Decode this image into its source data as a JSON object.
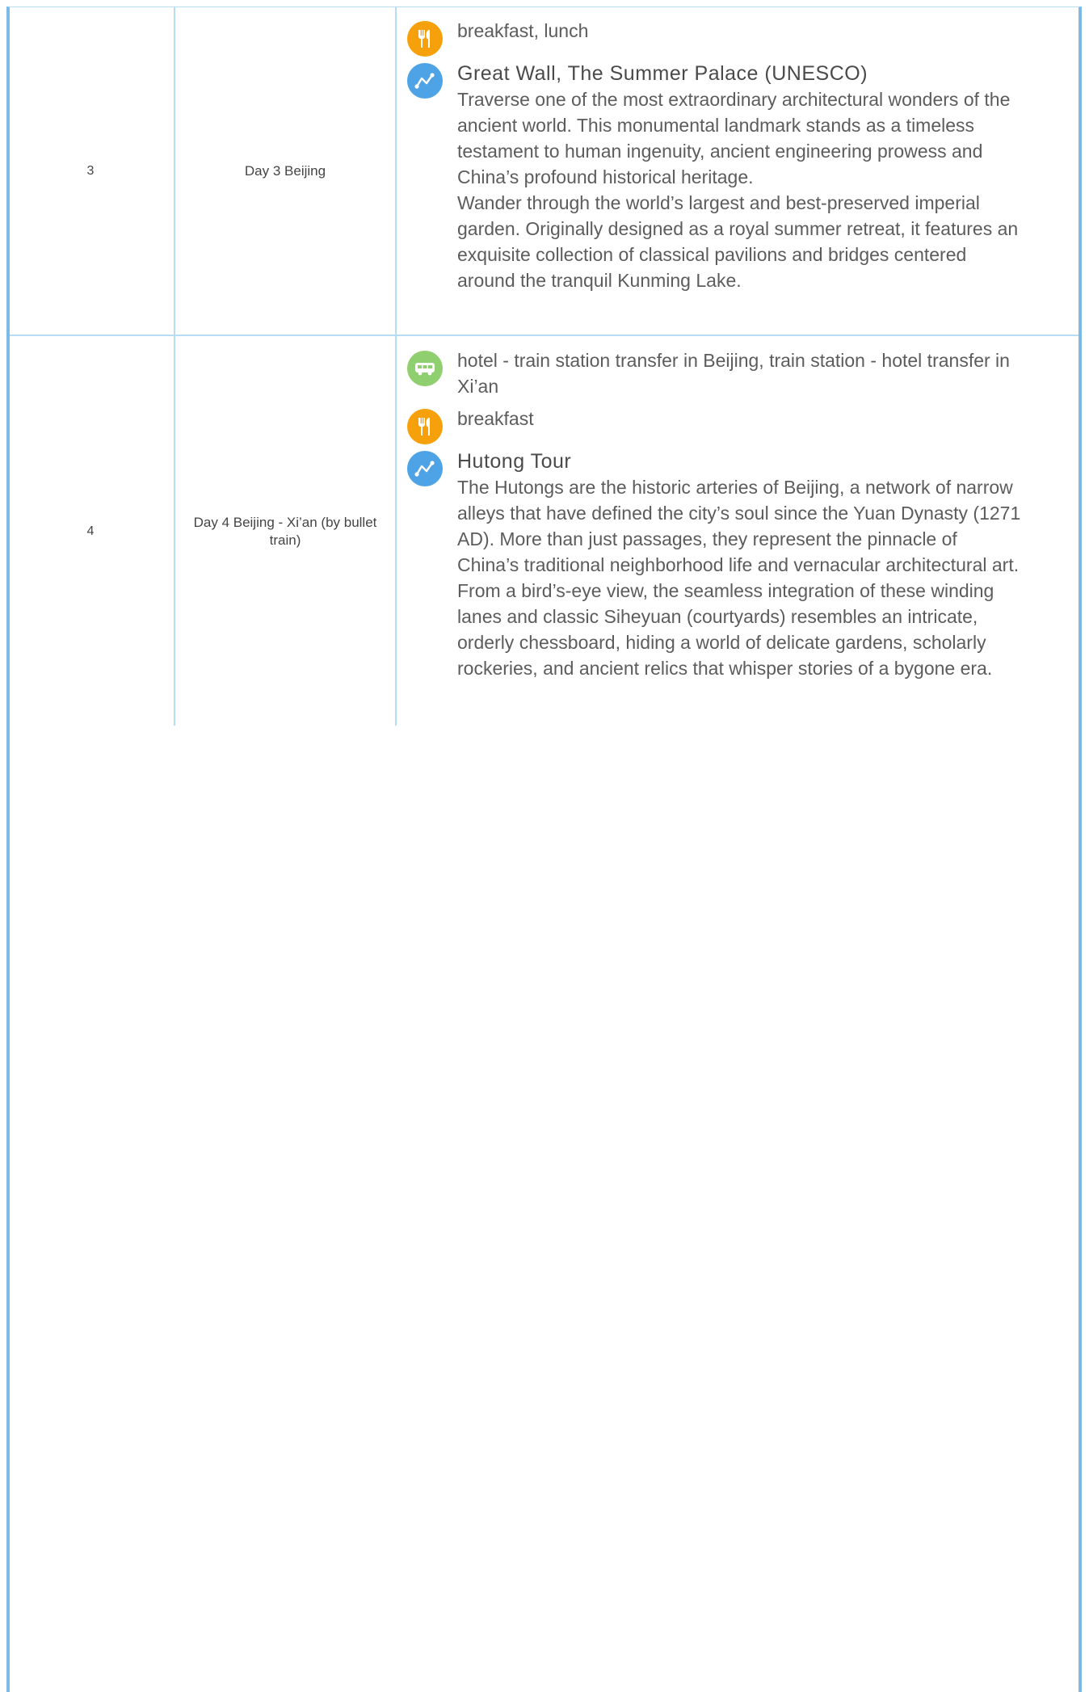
{
  "itinerary": {
    "rows": [
      {
        "number": "3",
        "day": "Day 3 Beijing",
        "meals": "breakfast, lunch",
        "sight_title": "Great Wall, The Summer Palace (UNESCO)",
        "sight_desc_1": "Traverse one of the most extraordinary architectural wonders of the ancient world. This monumental landmark stands as a timeless testament to human ingenuity, ancient engineering prowess and China’s profound historical heritage.",
        "sight_desc_2": "Wander through the world’s largest and best-preserved imperial garden. Originally designed as a royal summer retreat, it features an exquisite collection of classical pavilions and bridges centered around the tranquil Kunming Lake."
      },
      {
        "number": "4",
        "day": "Day 4 Beijing - Xi’an (by bullet train)",
        "transfer": "hotel - train station transfer in Beijing, train station - hotel transfer in Xi’an",
        "meals": "breakfast",
        "sight_title": "Hutong Tour",
        "sight_desc": "The Hutongs are the historic arteries of Beijing, a network of narrow alleys that have defined the city’s soul since the Yuan Dynasty (1271 AD). More than just passages, they represent the pinnacle of China’s traditional neighborhood life and vernacular architectural art. From a bird’s-eye view, the seamless integration of these winding lanes and classic Siheyuan (courtyards) resembles an intricate, orderly chessboard, hiding a world of delicate gardens, scholarly rockeries, and ancient relics that whisper stories of a bygone era."
      }
    ],
    "icons": {
      "meal": "fork-knife-icon",
      "sight": "route-icon",
      "transfer": "bus-icon"
    },
    "colors": {
      "border": "#7cbbe9",
      "grid": "#b7dcf5",
      "meal_icon": "#f6a10b",
      "sight_icon": "#4ea2e6",
      "transfer_icon": "#8fcf6f"
    }
  }
}
